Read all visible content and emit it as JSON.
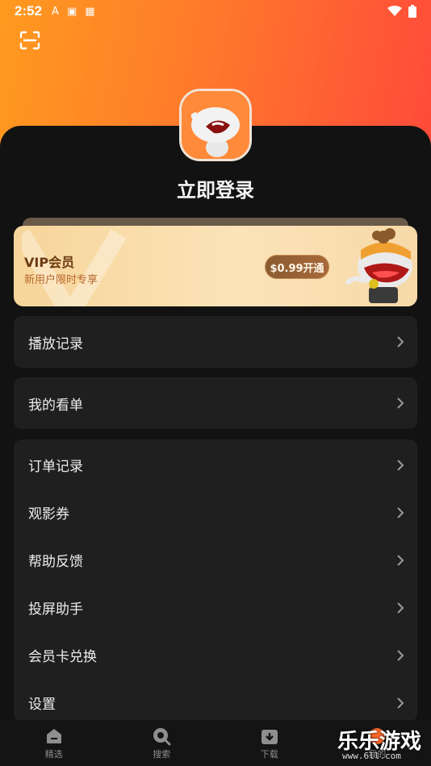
{
  "status": {
    "time": "2:52",
    "icons": [
      "A",
      "▣",
      "▦"
    ]
  },
  "login_label": "立即登录",
  "vip": {
    "title": "VIP会员",
    "subtitle": "新用户限时专享",
    "button": "$0.99开通"
  },
  "menu_groups": [
    [
      "播放记录"
    ],
    [
      "我的看单"
    ],
    [
      "订单记录",
      "观影券",
      "帮助反馈",
      "投屏助手",
      "会员卡兑换",
      "设置"
    ]
  ],
  "tabs": [
    {
      "label": "精选",
      "icon": "home-icon"
    },
    {
      "label": "搜索",
      "icon": "search-icon"
    },
    {
      "label": "下载",
      "icon": "download-icon"
    },
    {
      "label": "我的",
      "icon": "profile-icon"
    }
  ],
  "watermark": {
    "main": "乐乐游戏",
    "sub": "www.6ll.com"
  },
  "colors": {
    "accent_orange": "#ff8a25",
    "accent_red": "#ff4a3a",
    "panel": "#121212",
    "card": "#1f1f1f"
  }
}
